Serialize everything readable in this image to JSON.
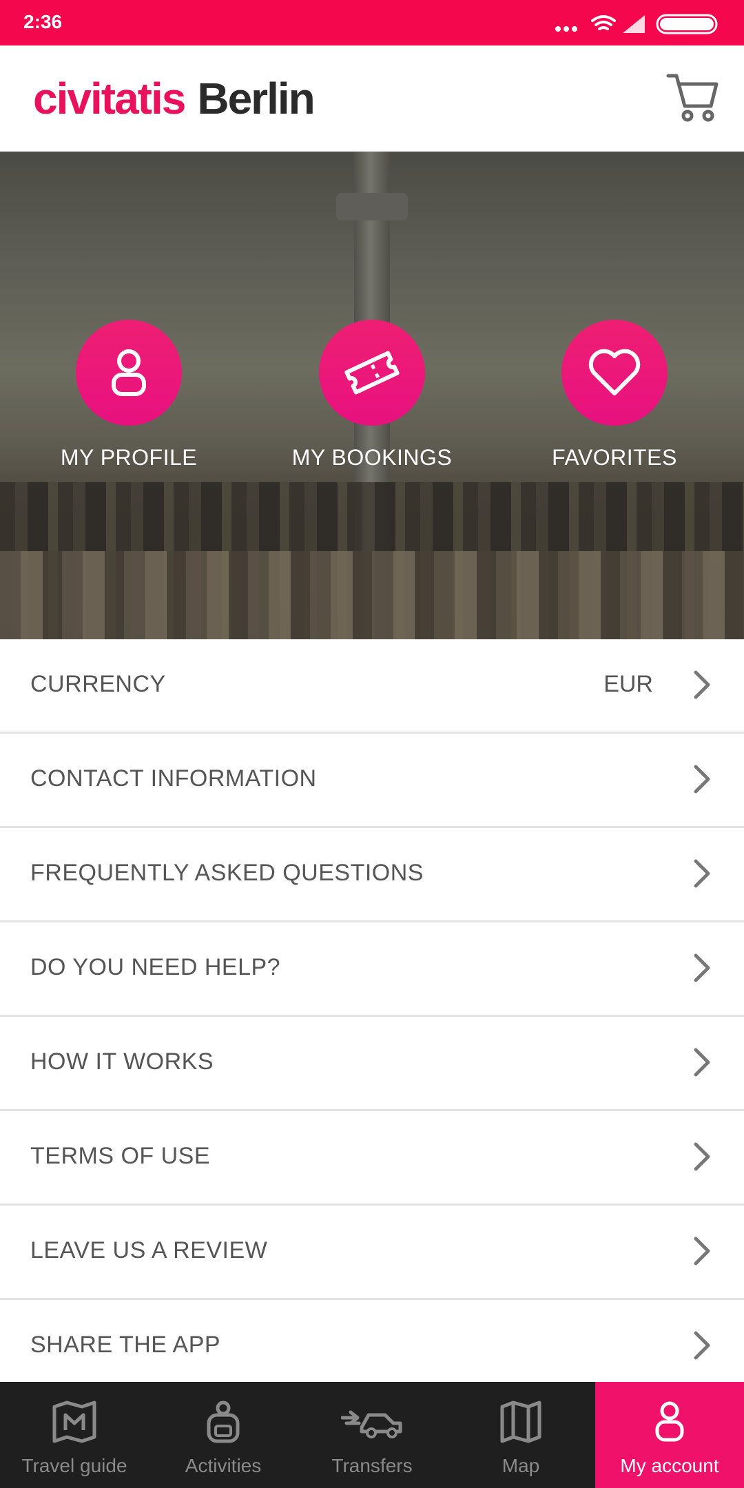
{
  "status_bar": {
    "time": "2:36"
  },
  "header": {
    "logo": "civitatis",
    "city": "Berlin"
  },
  "hero": {
    "actions": [
      {
        "label": "MY PROFILE",
        "icon": "user-icon"
      },
      {
        "label": "MY BOOKINGS",
        "icon": "ticket-icon"
      },
      {
        "label": "FAVORITES",
        "icon": "heart-icon"
      }
    ]
  },
  "menu": [
    {
      "label": "CURRENCY",
      "value": "EUR"
    },
    {
      "label": "CONTACT INFORMATION"
    },
    {
      "label": "FREQUENTLY ASKED QUESTIONS"
    },
    {
      "label": "DO YOU NEED HELP?"
    },
    {
      "label": "HOW IT WORKS"
    },
    {
      "label": "TERMS OF USE"
    },
    {
      "label": "LEAVE US A REVIEW"
    },
    {
      "label": "SHARE THE APP"
    }
  ],
  "tabs": [
    {
      "label": "Travel guide",
      "icon": "map-book-icon"
    },
    {
      "label": "Activities",
      "icon": "backpack-icon"
    },
    {
      "label": "Transfers",
      "icon": "car-icon"
    },
    {
      "label": "Map",
      "icon": "map-icon"
    },
    {
      "label": "My account",
      "icon": "user-icon",
      "active": true
    }
  ],
  "colors": {
    "brand": "#f5074e",
    "accent": "#e9115b",
    "tabbar": "#1f1f1f"
  }
}
